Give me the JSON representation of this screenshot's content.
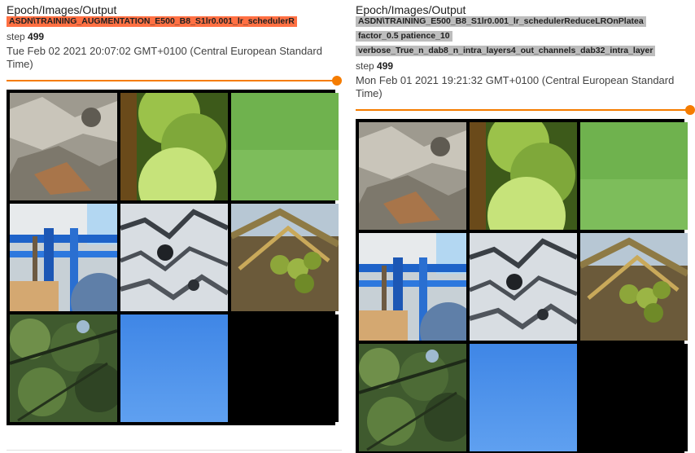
{
  "cards": [
    {
      "title": "Epoch/Images/Output",
      "run_tag_lines": [
        "ASDN\\TRAINING_AUGMENTATION_E500_B8_S1lr0.001_lr_schedulerR"
      ],
      "tag_color": "#ff7043",
      "step_label": "step",
      "step_value": "499",
      "timestamp": "Tue Feb 02 2021 20:07:02 GMT+0100 (Central European Standard Time)",
      "slider_value": 1.0
    },
    {
      "title": "Epoch/Images/Output",
      "run_tag_lines": [
        "ASDN\\TRAINING_E500_B8_S1lr0.001_lr_schedulerReduceLROnPlatea",
        "factor_0.5 patience_10",
        "verbose_True_n_dab8_n_intra_layers4_out_channels_dab32_intra_layer"
      ],
      "tag_color": "#bdbdbd",
      "step_label": "step",
      "step_value": "499",
      "timestamp": "Mon Feb 01 2021 19:21:32 GMT+0100 (Central European Standard Time)",
      "slider_value": 1.0
    }
  ],
  "tiles": [
    "rock-texture-image",
    "green-fruit-image",
    "green-blur-image",
    "blue-railing-image",
    "speckled-texture-image",
    "palm-coconuts-image",
    "tree-foliage-image",
    "blue-sky-image",
    "black-empty-image"
  ],
  "accent_color": "#f57c00"
}
